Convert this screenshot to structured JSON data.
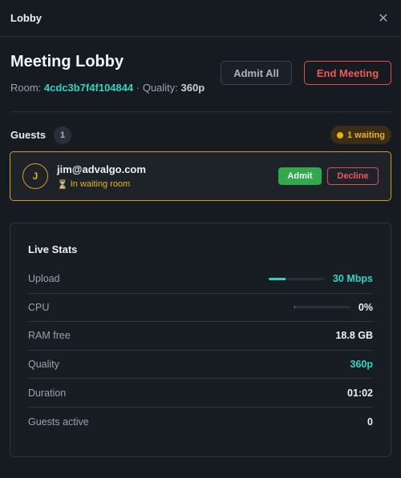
{
  "window": {
    "title": "Lobby",
    "close_icon": "close-icon"
  },
  "header": {
    "title": "Meeting Lobby",
    "room_label": "Room:",
    "room_code": "4cdc3b7f4f104844",
    "separator": "·",
    "quality_label": "Quality:",
    "quality_value": "360p",
    "admit_all_label": "Admit All",
    "end_meeting_label": "End Meeting"
  },
  "guests": {
    "label": "Guests",
    "count": "1",
    "waiting_badge": "1 waiting",
    "list": [
      {
        "initial": "J",
        "email": "jim@advalgo.com",
        "status_icon": "hourglass-icon",
        "status": "In waiting room",
        "admit_label": "Admit",
        "decline_label": "Decline"
      }
    ]
  },
  "live_stats": {
    "title": "Live Stats",
    "upload": {
      "label": "Upload",
      "value": "30 Mbps",
      "fill_fraction": 0.3
    },
    "cpu": {
      "label": "CPU",
      "value": "0%",
      "fill_fraction": 0.01
    },
    "ram": {
      "label": "RAM free",
      "value": "18.8 GB"
    },
    "quality": {
      "label": "Quality",
      "value": "360p"
    },
    "duration": {
      "label": "Duration",
      "value": "01:02"
    },
    "guests_active": {
      "label": "Guests active",
      "value": "0"
    }
  },
  "colors": {
    "accent_teal": "#2dd4bf",
    "warning_amber": "#eab308",
    "danger_red": "#ef5a54",
    "success_green": "#2fa94c"
  }
}
